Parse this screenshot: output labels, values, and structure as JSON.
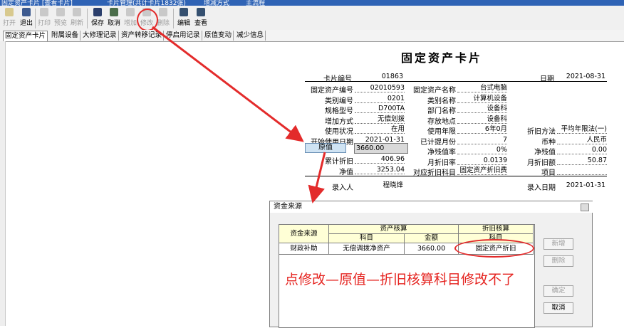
{
  "window": {
    "tabs": [
      "固定资产卡片 [查看卡片]",
      "卡片管理(共计卡片1832张)",
      "增减方式",
      "主流程"
    ]
  },
  "toolbar": {
    "buttons": [
      {
        "label": "打开",
        "icon": "folder-open-icon",
        "enabled": false
      },
      {
        "label": "退出",
        "icon": "exit-icon",
        "enabled": true
      },
      {
        "label": "打印",
        "icon": "print-icon",
        "enabled": false
      },
      {
        "label": "预览",
        "icon": "preview-icon",
        "enabled": false
      },
      {
        "label": "刷新",
        "icon": "refresh-icon",
        "enabled": false
      },
      {
        "label": "保存",
        "icon": "save-icon",
        "enabled": true
      },
      {
        "label": "取消",
        "icon": "cancel-icon",
        "enabled": true
      },
      {
        "label": "增加",
        "icon": "add-icon",
        "enabled": false
      },
      {
        "label": "修改",
        "icon": "edit-icon",
        "enabled": false
      },
      {
        "label": "删除",
        "icon": "delete-icon",
        "enabled": false
      },
      {
        "label": "编辑",
        "icon": "edit-doc-icon",
        "enabled": true
      },
      {
        "label": "查看",
        "icon": "view-icon",
        "enabled": true
      }
    ]
  },
  "card_tabs": [
    "固定资产卡片",
    "附属设备",
    "大修理记录",
    "资产转移记录",
    "停启用记录",
    "原值变动",
    "减少信息"
  ],
  "card": {
    "title": "固定资产卡片",
    "card_no_label": "卡片编号",
    "card_no": "01863",
    "date_label": "日期",
    "date": "2021-08-31",
    "left": [
      {
        "label": "固定资产编号",
        "value": "02010593"
      },
      {
        "label": "类别编号",
        "value": "0201"
      },
      {
        "label": "规格型号",
        "value": "D700TA"
      },
      {
        "label": "增加方式",
        "value": "无偿划拨"
      },
      {
        "label": "使用状况",
        "value": "在用"
      },
      {
        "label": "开始使用日期",
        "value": "2021-01-31"
      }
    ],
    "mid": [
      {
        "label": "固定资产名称",
        "value": "台式电脑"
      },
      {
        "label": "类别名称",
        "value": "计算机设备"
      },
      {
        "label": "部门名称",
        "value": "设备科"
      },
      {
        "label": "存放地点",
        "value": "设备科"
      },
      {
        "label": "使用年限",
        "value": "6年0月"
      },
      {
        "label": "已计提月份",
        "value": "7"
      },
      {
        "label": "净残值率",
        "value": "0%"
      },
      {
        "label": "月折旧率",
        "value": "0.0139"
      },
      {
        "label": "对应折旧科目",
        "value": "固定资产折旧费"
      }
    ],
    "right": [
      {
        "label": "折旧方法",
        "value": "平均年限法(一)"
      },
      {
        "label": "币种",
        "value": "人民币"
      },
      {
        "label": "净残值",
        "value": "0.00"
      },
      {
        "label": "月折旧额",
        "value": "50.87"
      },
      {
        "label": "项目",
        "value": ""
      }
    ],
    "original_value_label": "原值",
    "original_value": "3660.00",
    "accum_dep_label": "累计折旧",
    "accum_dep": "406.96",
    "net_value_label": "净值",
    "net_value": "3253.04",
    "entered_by_label": "录入人",
    "entered_by": "程晓烽",
    "entry_date_label": "录入日期",
    "entry_date": "2021-01-31"
  },
  "dialog": {
    "title": "资金来源",
    "col_source": "资金来源",
    "grp_asset": "资产核算",
    "grp_dep": "折旧核算",
    "col_subject": "科目",
    "col_amount": "金额",
    "col_dep_subject": "科目",
    "row": {
      "source": "财政补助",
      "subject": "无偿调拨净资产",
      "amount": "3660.00",
      "dep_subject": "固定资产折旧"
    },
    "buttons": [
      {
        "label": "新增",
        "enabled": false
      },
      {
        "label": "删除",
        "enabled": false
      },
      {
        "label": "确定",
        "enabled": false
      },
      {
        "label": "取消",
        "enabled": true
      }
    ]
  },
  "annotation": "点修改—原值—折旧核算科目修改不了",
  "colors": {
    "annotation": "#e5231f",
    "titlebar": "#2f63b5",
    "grid_header": "#ffffd6",
    "origin_button": "#cfe3f3"
  }
}
